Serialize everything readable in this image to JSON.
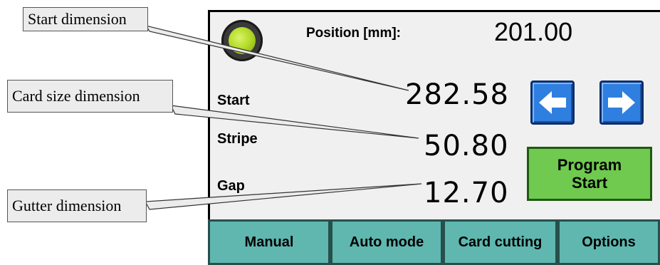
{
  "hmi": {
    "position_label": "Position [mm]:",
    "position_value": "201.00",
    "start_label": "Start",
    "start_value": "282.58",
    "stripe_label": "Stripe",
    "stripe_value": "50.80",
    "gap_label": "Gap",
    "gap_value": "12.70",
    "program_start_line1": "Program",
    "program_start_line2": "Start",
    "tabs": [
      {
        "label": "Manual"
      },
      {
        "label": "Auto mode"
      },
      {
        "label": "Card cutting"
      },
      {
        "label": "Options"
      }
    ],
    "indicator_color": "#b5dd2a",
    "arrow_color": "#2f7fe0",
    "program_button_color": "#6fca4f",
    "tab_color": "#5fb7b0",
    "left_arrow_icon": "arrow-left-icon",
    "right_arrow_icon": "arrow-right-icon"
  },
  "annotations": {
    "start": "Start dimension",
    "card_size": "Card size dimension",
    "gutter": "Gutter dimension"
  }
}
